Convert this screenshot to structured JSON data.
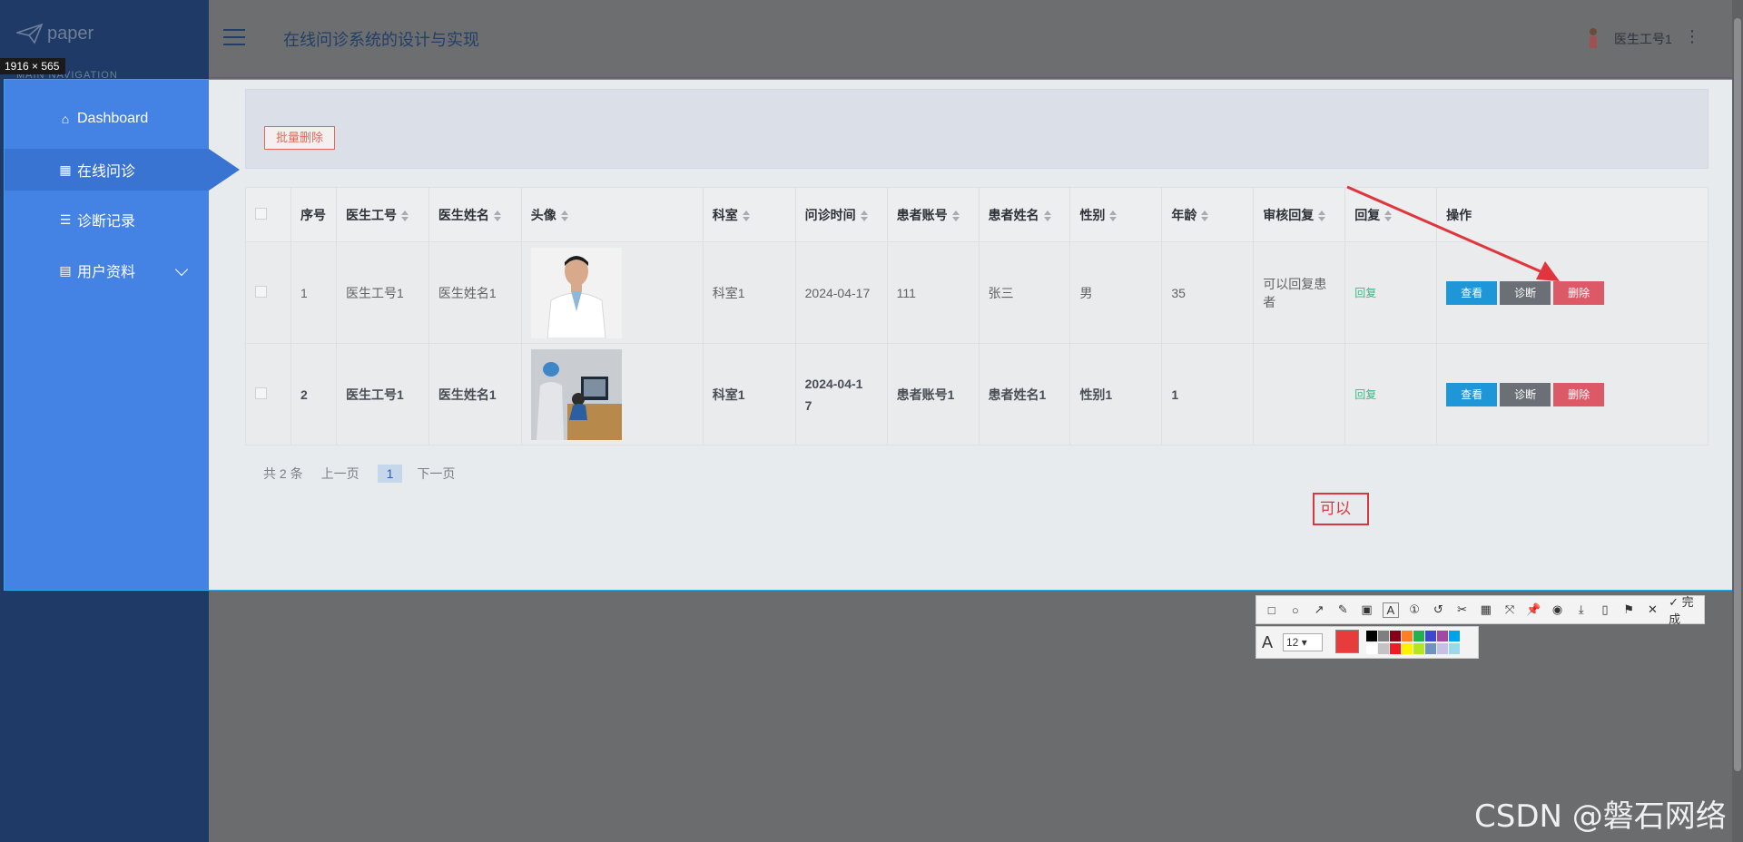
{
  "app": {
    "logo_text": "paper",
    "main_nav_label": "MAIN NAVIGATION",
    "title": "在线问诊系统的设计与实现",
    "user_name": "医生工号1",
    "more": "⋮"
  },
  "capture": {
    "dimensions": "1916 × 565"
  },
  "sidebar": {
    "items": [
      {
        "label": "Dashboard",
        "icon": "⌂"
      },
      {
        "label": "在线问诊",
        "icon": "▦"
      },
      {
        "label": "诊断记录",
        "icon": "☰"
      },
      {
        "label": "用户资料",
        "icon": "▤"
      }
    ]
  },
  "toolbar_btn": {
    "batch_delete": "批量删除"
  },
  "table": {
    "headers": [
      "序号",
      "医生工号",
      "医生姓名",
      "头像",
      "科室",
      "问诊时间",
      "患者账号",
      "患者姓名",
      "性别",
      "年龄",
      "审核回复",
      "回复",
      "操作"
    ],
    "rows": [
      {
        "no": "1",
        "doc_id": "医生工号1",
        "doc_name": "医生姓名1",
        "dept": "科室1",
        "time": "2024-04-17",
        "pat_acc": "111",
        "pat_name": "张三",
        "gender": "男",
        "age": "35",
        "review": "可以回复患者",
        "reply": "回复"
      },
      {
        "no": "2",
        "doc_id": "医生工号1",
        "doc_name": "医生姓名1",
        "dept": "科室1",
        "time": "2024-04-1\n7",
        "pat_acc": "患者账号1",
        "pat_name": "患者姓名1",
        "gender": "性别1",
        "age": "1",
        "review": "",
        "reply": "回复"
      }
    ],
    "actions": {
      "view": "查看",
      "diagnose": "诊断",
      "delete": "删除"
    }
  },
  "pager": {
    "total": "共 2 条",
    "prev": "上一页",
    "current": "1",
    "next": "下一页"
  },
  "annotation": {
    "text": "可以"
  },
  "capture_toolbar": {
    "done": "完成",
    "font_size": "12",
    "current_color": "#e83c3c",
    "palette": [
      "#000000",
      "#7f7f7f",
      "#880015",
      "#ff7f27",
      "#22b14c",
      "#3f48cc",
      "#a349a4",
      "#00a2e8",
      "#ffffff",
      "#c3c3c3",
      "#ed1c24",
      "#fff200",
      "#b5e61d",
      "#7092be",
      "#c8bfe7",
      "#99d9ea"
    ]
  },
  "watermark": "CSDN @磐石网络"
}
